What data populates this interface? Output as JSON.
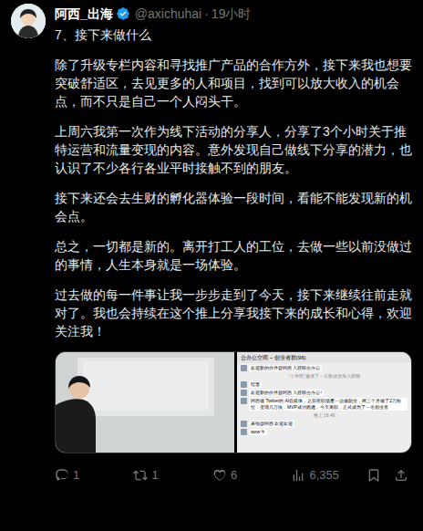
{
  "author": {
    "name": "阿西_出海",
    "handle": "@axichuhai",
    "separator": "·",
    "time": "19小时",
    "verified": true
  },
  "body": {
    "title": "7、接下来做什么",
    "paragraphs": [
      "除了升级专栏内容和寻找推广产品的合作方外，接下来我也想要突破舒适区，去见更多的人和项目，找到可以放大收入的机会点，而不只是自己一个人闷头干。",
      "上周六我第一次作为线下活动的分享人，分享了3个小时关于推特运营和流量变现的内容。意外发现自己做线下分享的潜力，也认识了不少各行各业平时接触不到的朋友。",
      "接下来还会去生财的孵化器体验一段时间，看能不能发现新的机会点。",
      "总之，一切都是新的。离开打工人的工位，去做一些以前没做过的事情，人生本身就是一场体验。",
      "过去做的每一件事让我一步步走到了今天，接下来继续往前走就对了。我也会持续在这个推上分享我接下来的成长和心得，欢迎关注我！"
    ]
  },
  "chat": {
    "title": "合办公空间 ~ 创业者群(96)",
    "messages": [
      {
        "kind": "bubble",
        "text": "欢迎新的伙伴@阿西 入驻联合办公"
      },
      {
        "kind": "system",
        "text": "\"小米吧\"邀请了一名新成员加入群聊"
      },
      {
        "kind": "bubble",
        "text": "哇塞"
      },
      {
        "kind": "bubble",
        "text": "欢迎新的伙伴@阿西 入驻联合办公!"
      },
      {
        "kind": "bubble",
        "text": "阿西做 Twitter的 AI自媒体，之前在职场里一边做副业，两三个月做了2万粉丝，变现几万块，MVP成功跑通，今天离职，正式成为了一名创业者"
      },
      {
        "kind": "time",
        "text": "晚上 16:46"
      },
      {
        "kind": "bubble",
        "text": "来啦@阿西 欢迎欢迎"
      },
      {
        "kind": "bubble",
        "text": "wow 牛"
      }
    ]
  },
  "actions": [
    {
      "kind": "reply",
      "count": "1"
    },
    {
      "kind": "retweet",
      "count": "1"
    },
    {
      "kind": "like",
      "count": "6"
    },
    {
      "kind": "views",
      "count": "6,355"
    },
    {
      "kind": "bookmark",
      "count": ""
    },
    {
      "kind": "share",
      "count": ""
    }
  ]
}
